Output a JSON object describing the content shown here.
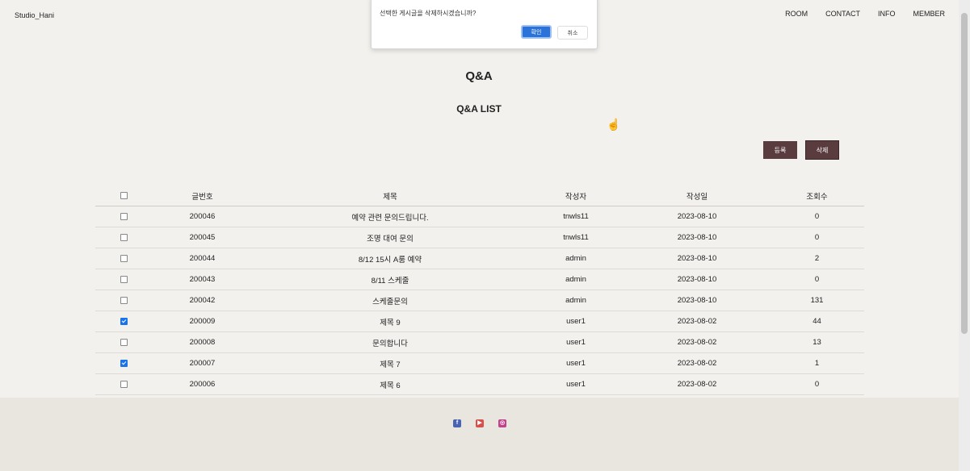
{
  "header": {
    "logo": "Studio_Hani",
    "nav": [
      "ROOM",
      "CONTACT",
      "INFO",
      "MEMBER"
    ]
  },
  "dialog": {
    "message": "선택한 게시글을 삭제하시겠습니까?",
    "ok_label": "확인",
    "cancel_label": "취소"
  },
  "main": {
    "title": "Q&A",
    "subtitle": "Q&A LIST",
    "register_label": "등록",
    "delete_label": "삭제"
  },
  "table": {
    "headers": [
      "글번호",
      "제목",
      "작성자",
      "작성일",
      "조회수"
    ],
    "rows": [
      {
        "checked": false,
        "no": "200046",
        "title": "예약 관련 문의드립니다.",
        "writer": "tnwls11",
        "date": "2023-08-10",
        "views": "0"
      },
      {
        "checked": false,
        "no": "200045",
        "title": "조명 대여 문의",
        "writer": "tnwls11",
        "date": "2023-08-10",
        "views": "0"
      },
      {
        "checked": false,
        "no": "200044",
        "title": "8/12 15시 A룸 예약",
        "writer": "admin",
        "date": "2023-08-10",
        "views": "2"
      },
      {
        "checked": false,
        "no": "200043",
        "title": "8/11 스케줄",
        "writer": "admin",
        "date": "2023-08-10",
        "views": "0"
      },
      {
        "checked": false,
        "no": "200042",
        "title": "스케줄문의",
        "writer": "admin",
        "date": "2023-08-10",
        "views": "131"
      },
      {
        "checked": true,
        "no": "200009",
        "title": "제목 9",
        "writer": "user1",
        "date": "2023-08-02",
        "views": "44"
      },
      {
        "checked": false,
        "no": "200008",
        "title": "문의합니다",
        "writer": "user1",
        "date": "2023-08-02",
        "views": "13"
      },
      {
        "checked": true,
        "no": "200007",
        "title": "제목 7",
        "writer": "user1",
        "date": "2023-08-02",
        "views": "1"
      },
      {
        "checked": false,
        "no": "200006",
        "title": "제목 6",
        "writer": "user1",
        "date": "2023-08-02",
        "views": "0"
      }
    ]
  },
  "footer": {
    "social_icons": [
      "facebook-icon",
      "youtube-icon",
      "instagram-icon"
    ]
  },
  "colors": {
    "background": "#f3f1ee",
    "button": "#5a3c3f",
    "footer": "#e9e5df",
    "ok_button": "#2b73d8"
  }
}
